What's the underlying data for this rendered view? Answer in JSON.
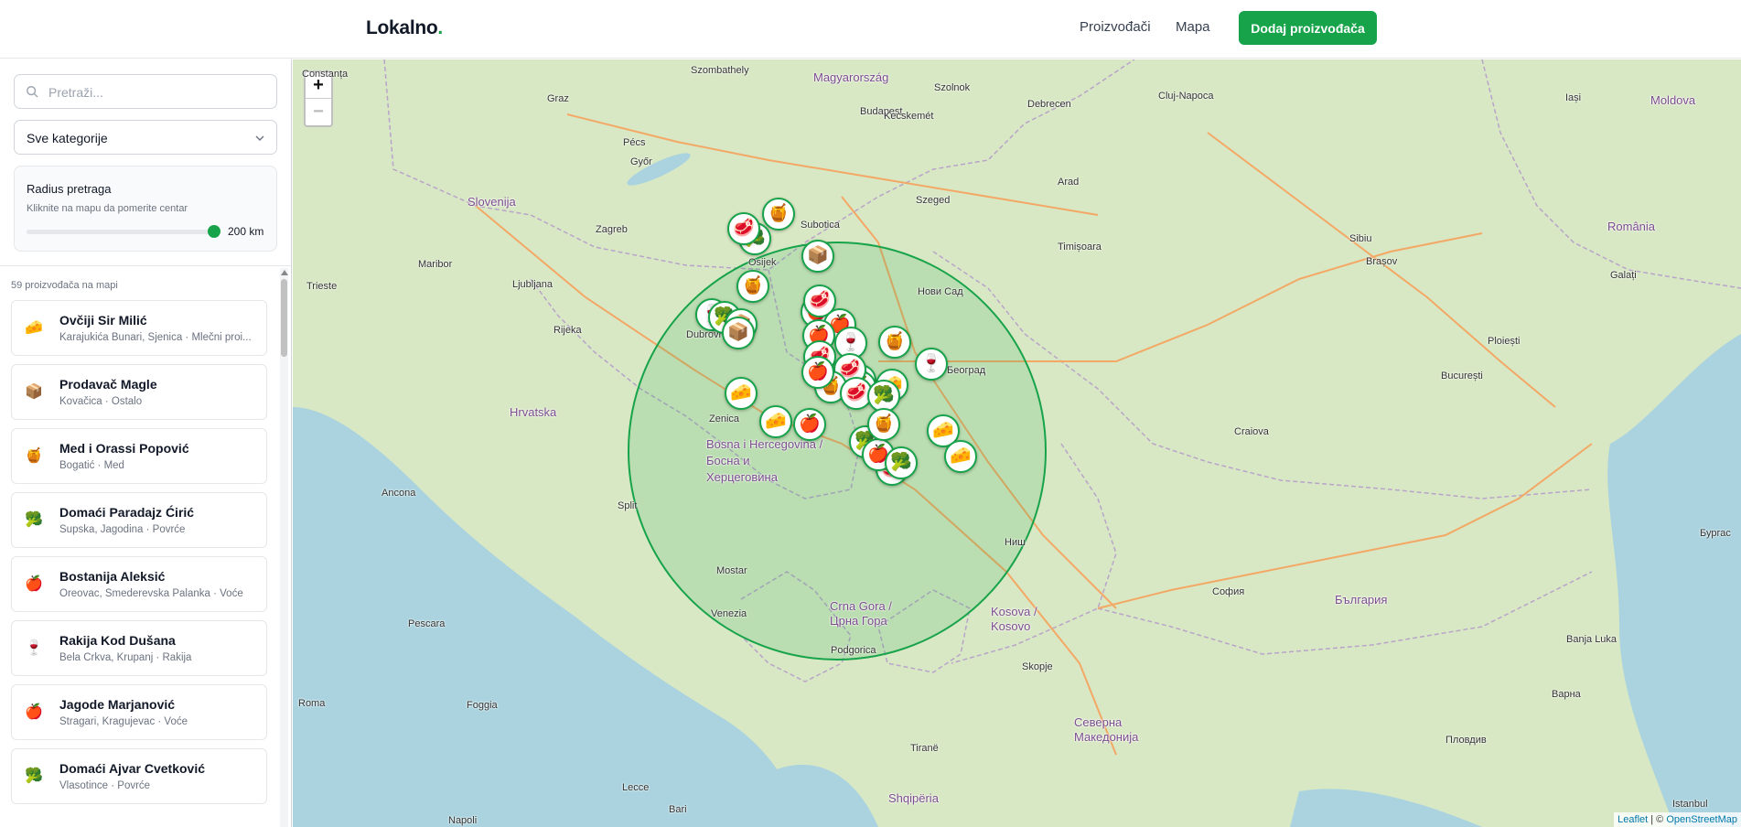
{
  "header": {
    "logo_text": "Lokalno",
    "logo_dot": ".",
    "nav": [
      "Proizvođači",
      "Mapa"
    ],
    "add_button": "Dodaj proizvođača"
  },
  "sidebar": {
    "search_placeholder": "Pretraži...",
    "category_select": "Sve kategorije",
    "radius": {
      "title": "Radius pretraga",
      "hint": "Kliknite na mapu da pomerite centar",
      "value_label": "200 km",
      "value_fraction": 1.0
    },
    "count_label": "59 proizvođača na mapi",
    "items": [
      {
        "name": "Ovčiji Sir Milić",
        "meta": "Karajukića Bunari, Sjenica · Mlečni proi...",
        "icon": "🧀"
      },
      {
        "name": "Prodavač Magle",
        "meta": "Kovačica · Ostalo",
        "icon": "📦"
      },
      {
        "name": "Med i Orassi Popović",
        "meta": "Bogatić · Med",
        "icon": "🍯"
      },
      {
        "name": "Domaći Paradajz Ćirić",
        "meta": "Supska, Jagodina · Povrće",
        "icon": "🥦"
      },
      {
        "name": "Bostanija Aleksić",
        "meta": "Oreovac, Smederevska Palanka · Voće",
        "icon": "🍎"
      },
      {
        "name": "Rakija Kod Dušana",
        "meta": "Bela Crkva, Krupanj · Rakija",
        "icon": "🍷"
      },
      {
        "name": "Jagode Marjanović",
        "meta": "Stragari, Kragujevac · Voće",
        "icon": "🍎"
      },
      {
        "name": "Domaći Ajvar Cvetković",
        "meta": "Vlasotince · Povrće",
        "icon": "🥦"
      }
    ]
  },
  "map": {
    "zoom_in": "+",
    "zoom_out": "−",
    "attribution_leaflet": "Leaflet",
    "attribution_sep": " | © ",
    "attribution_osm": "OpenStreetMap",
    "colors": {
      "accent": "#16a34a",
      "land": "#d8e8c4",
      "sea": "#aad3df"
    },
    "labels": [
      {
        "text": "Magyarország",
        "cls": "country"
      },
      {
        "text": "România",
        "cls": "country"
      },
      {
        "text": "Slovenija",
        "cls": "country"
      },
      {
        "text": "Hrvatska",
        "cls": "country"
      },
      {
        "text": "Bosna i Hercegovina /",
        "cls": "country"
      },
      {
        "text": "Босна и",
        "cls": "country"
      },
      {
        "text": "Херцеговина",
        "cls": "country"
      },
      {
        "text": "Crna Gora /",
        "cls": "country"
      },
      {
        "text": "Црна Гора",
        "cls": "country"
      },
      {
        "text": "Kosova /",
        "cls": "country"
      },
      {
        "text": "Kosovo",
        "cls": "country"
      },
      {
        "text": "Shqipëria",
        "cls": "country"
      },
      {
        "text": "Северна",
        "cls": "country"
      },
      {
        "text": "Македонија",
        "cls": "country"
      },
      {
        "text": "България",
        "cls": "country"
      },
      {
        "text": "Moldova",
        "cls": "country"
      },
      {
        "text": "Szombathely",
        "cls": ""
      },
      {
        "text": "Graz",
        "cls": ""
      },
      {
        "text": "Győr",
        "cls": ""
      },
      {
        "text": "Budapest",
        "cls": ""
      },
      {
        "text": "Szolnok",
        "cls": ""
      },
      {
        "text": "Debrecen",
        "cls": ""
      },
      {
        "text": "Kecskemét",
        "cls": ""
      },
      {
        "text": "Szeged",
        "cls": ""
      },
      {
        "text": "Arad",
        "cls": ""
      },
      {
        "text": "Timișoara",
        "cls": ""
      },
      {
        "text": "Cluj-Napoca",
        "cls": ""
      },
      {
        "text": "Sibiu",
        "cls": ""
      },
      {
        "text": "Brașov",
        "cls": ""
      },
      {
        "text": "Iași",
        "cls": ""
      },
      {
        "text": "Zagreb",
        "cls": ""
      },
      {
        "text": "Ljubljana",
        "cls": ""
      },
      {
        "text": "Rijeka",
        "cls": ""
      },
      {
        "text": "Split",
        "cls": ""
      },
      {
        "text": "Mostar",
        "cls": ""
      },
      {
        "text": "Zenica",
        "cls": ""
      },
      {
        "text": "Ancona",
        "cls": ""
      },
      {
        "text": "Pescara",
        "cls": ""
      },
      {
        "text": "Roma",
        "cls": ""
      },
      {
        "text": "Napoli",
        "cls": ""
      },
      {
        "text": "Bari",
        "cls": ""
      },
      {
        "text": "Podgorica",
        "cls": ""
      },
      {
        "text": "Tiranë",
        "cls": ""
      },
      {
        "text": "Skopje",
        "cls": ""
      },
      {
        "text": "София",
        "cls": ""
      },
      {
        "text": "București",
        "cls": ""
      },
      {
        "text": "Craiova",
        "cls": ""
      },
      {
        "text": "Београд",
        "cls": ""
      },
      {
        "text": "Нови Сад",
        "cls": ""
      },
      {
        "text": "Ниш",
        "cls": ""
      },
      {
        "text": "Пловдив",
        "cls": ""
      },
      {
        "text": "Ploiești",
        "cls": ""
      },
      {
        "text": "Galați",
        "cls": ""
      },
      {
        "text": "Istanbul",
        "cls": ""
      },
      {
        "text": "Lecce",
        "cls": ""
      },
      {
        "text": "Foggia",
        "cls": ""
      },
      {
        "text": "Subotica",
        "cls": ""
      },
      {
        "text": "Osijek",
        "cls": ""
      },
      {
        "text": "Pécs",
        "cls": ""
      },
      {
        "text": "Maribor",
        "cls": ""
      },
      {
        "text": "Trieste",
        "cls": ""
      },
      {
        "text": "Venezia",
        "cls": ""
      },
      {
        "text": "Dubrovnik",
        "cls": ""
      },
      {
        "text": "Banja Luka",
        "cls": ""
      },
      {
        "text": "Варна",
        "cls": ""
      },
      {
        "text": "Бургас",
        "cls": ""
      },
      {
        "text": "Constanța",
        "cls": ""
      }
    ],
    "markers": [
      "🍯",
      "🥦",
      "🥩",
      "📦",
      "🍎",
      "🍷",
      "🧀",
      "🥩",
      "🥦",
      "🍎",
      "🍯",
      "🧀",
      "📦",
      "🍎",
      "🥩",
      "🍯",
      "🥦",
      "🍎",
      "🍷",
      "🧀",
      "🥦",
      "🍎",
      "🥩",
      "🍯",
      "🥩",
      "🍎",
      "🥦",
      "🧀",
      "🍷",
      "📦",
      "🥩",
      "🍎",
      "🥦",
      "🍯",
      "🧀"
    ]
  }
}
